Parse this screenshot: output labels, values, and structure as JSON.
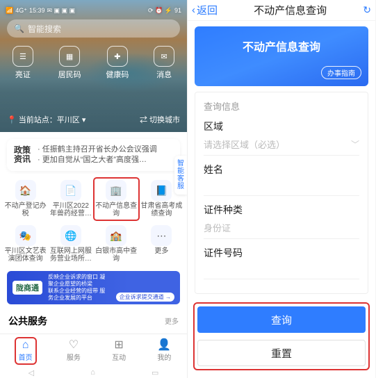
{
  "status": {
    "time": "15:39",
    "battery": "91"
  },
  "hero": {
    "search_placeholder": "智能搜索",
    "entries": [
      {
        "label": "亮证",
        "icon": "id-card"
      },
      {
        "label": "居民码",
        "icon": "qr"
      },
      {
        "label": "健康码",
        "icon": "health"
      },
      {
        "label": "消息",
        "icon": "bell"
      }
    ],
    "loc_prefix": "当前站点：",
    "loc_name": "平川区",
    "switch_city": "切换城市"
  },
  "news": {
    "tag_line1": "政策",
    "tag_line2": "资讯",
    "line1": "任振鹤主持召开省长办公会议强调",
    "line2": "更加自觉从“国之大者”高度强…"
  },
  "side_tab": "智能客服",
  "grid": {
    "row1": [
      {
        "label": "不动产登记办税",
        "hl": false
      },
      {
        "label": "平川区2022年兽药经营…",
        "hl": false
      },
      {
        "label": "不动产信息查询",
        "hl": true
      },
      {
        "label": "甘肃省高考成绩查询",
        "hl": false
      }
    ],
    "row2": [
      {
        "label": "平川区文艺表演团体查询",
        "hl": false
      },
      {
        "label": "互联网上网服务营业场所…",
        "hl": false
      },
      {
        "label": "白银市高中查询",
        "hl": false
      },
      {
        "label": "更多",
        "hl": false
      }
    ]
  },
  "banner": {
    "logo": "陇商通",
    "line1": "反映企业诉求的窗口  凝聚企业愿望的桥梁",
    "line2": "联系企业经营的纽带  服务企业发展的平台",
    "pill": "企业诉求提交通道  →"
  },
  "section": {
    "title": "公共服务",
    "more": "更多"
  },
  "tabs": [
    {
      "label": "首页",
      "active": true,
      "hl": true
    },
    {
      "label": "服务",
      "active": false,
      "hl": false
    },
    {
      "label": "互动",
      "active": false,
      "hl": false
    },
    {
      "label": "我的",
      "active": false,
      "hl": false
    }
  ],
  "right": {
    "back": "返回",
    "header_title": "不动产信息查询",
    "hero_title": "不动产信息查询",
    "guide": "办事指南",
    "card_header": "查询信息",
    "fields": {
      "region_label": "区域",
      "region_placeholder": "请选择区域（必选）",
      "name_label": "姓名",
      "idtype_label": "证件种类",
      "idtype_value": "身份证",
      "idno_label": "证件号码"
    },
    "query_btn": "查询",
    "reset_btn": "重置"
  },
  "colors": {
    "accent": "#2f7dff",
    "hl": "#d33"
  }
}
